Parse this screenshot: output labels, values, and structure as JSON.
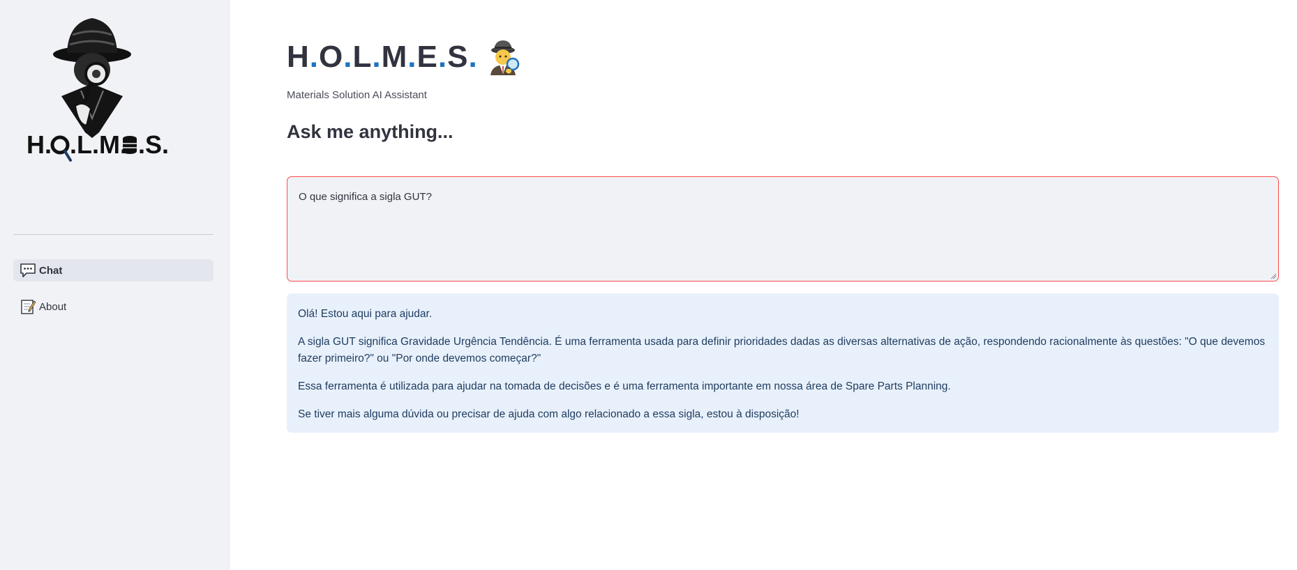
{
  "sidebar": {
    "logo_text": "H.O.L.M.S.S.",
    "nav": [
      {
        "label": "Chat",
        "icon": "speech-balloon-icon",
        "active": true
      },
      {
        "label": "About",
        "icon": "memo-icon",
        "active": false
      }
    ]
  },
  "main": {
    "title_parts": [
      "H",
      ".",
      "O",
      ".",
      "L",
      ".",
      "M",
      ".",
      "E",
      ".",
      "S",
      "."
    ],
    "title_emoji": "detective-emoji",
    "subtitle": "Materials Solution AI Assistant",
    "heading": "Ask me anything...",
    "question_value": "O que significa a sigla GUT?",
    "answer": {
      "p1": "Olá! Estou aqui para ajudar.",
      "p2": "A sigla GUT significa Gravidade Urgência Tendência. É uma ferramenta usada para definir prioridades dadas as diversas alternativas de ação, respondendo racionalmente às questões: \"O que devemos fazer primeiro?\" ou \"Por onde devemos começar?\"",
      "p3": "Essa ferramenta é utilizada para ajudar na tomada de decisões e é uma ferramenta importante em nossa área de Spare Parts Planning.",
      "p4": "Se tiver mais alguma dúvida ou precisar de ajuda com algo relacionado a essa sigla, estou à disposição!"
    }
  },
  "colors": {
    "sidebar_bg": "#f0f2f6",
    "accent_dot": "#1e73be",
    "input_border_focus": "#ff4b4b",
    "answer_bg": "#e8f1fb",
    "answer_text": "#1e3a5f"
  }
}
